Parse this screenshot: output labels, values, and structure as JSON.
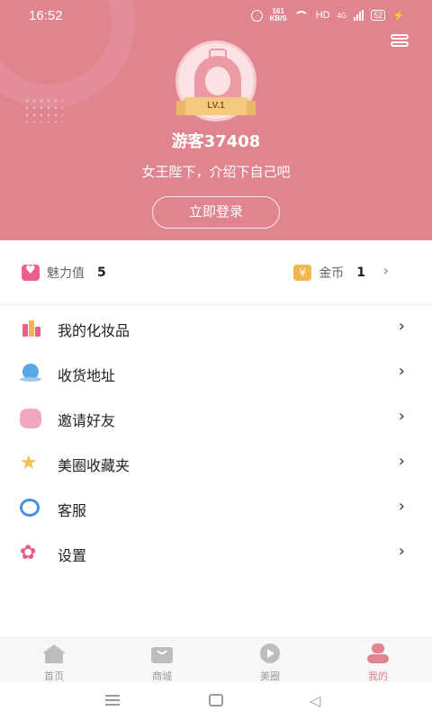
{
  "status_bar": {
    "time": "16:52",
    "net_speed_value": "161",
    "net_speed_unit": "KB/S",
    "hd": "HD",
    "network": "4G",
    "battery": "52"
  },
  "profile": {
    "level": "LV.1",
    "username": "游客37408",
    "tagline": "女王陛下，介绍下自己吧",
    "login_label": "立即登录"
  },
  "stats": {
    "charm_label": "魅力值",
    "charm_value": "5",
    "coins_label": "金币",
    "coins_value": "1",
    "coin_symbol": "¥"
  },
  "menu": [
    {
      "label": "我的化妆品",
      "icon": "cosmetics-icon"
    },
    {
      "label": "收货地址",
      "icon": "location-icon"
    },
    {
      "label": "邀请好友",
      "icon": "invite-icon"
    },
    {
      "label": "美圈收藏夹",
      "icon": "star-icon"
    },
    {
      "label": "客服",
      "icon": "headset-icon"
    },
    {
      "label": "设置",
      "icon": "gear-icon"
    }
  ],
  "bottom_nav": [
    {
      "label": "首页",
      "icon": "home-icon"
    },
    {
      "label": "商城",
      "icon": "shop-bag-icon"
    },
    {
      "label": "美圈",
      "icon": "play-icon"
    },
    {
      "label": "我的",
      "icon": "user-icon",
      "active": true
    }
  ],
  "colors": {
    "brand": "#e0848f",
    "charm": "#e9608a",
    "coin": "#f2b64f"
  }
}
